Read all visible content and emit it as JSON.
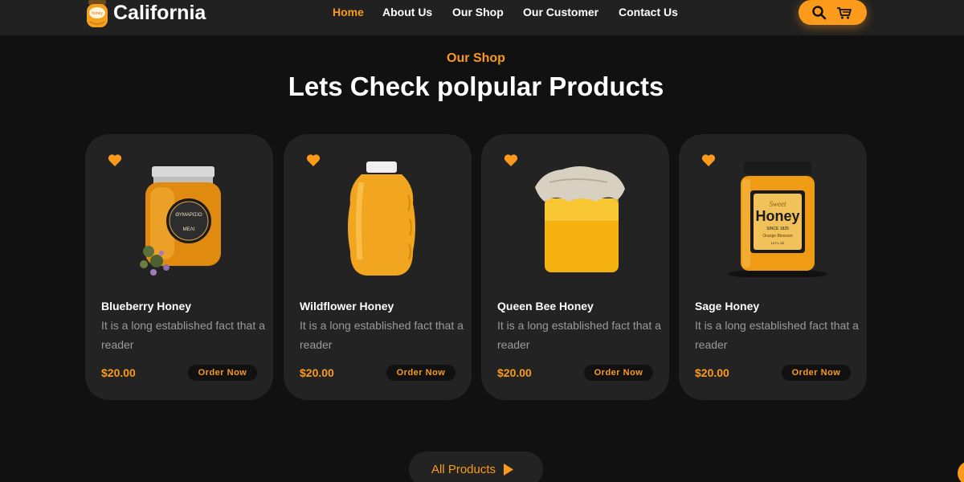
{
  "brand": {
    "name": "California",
    "jar_label": "honey"
  },
  "nav": {
    "items": [
      {
        "label": "Home",
        "active": true
      },
      {
        "label": "About Us",
        "active": false
      },
      {
        "label": "Our Shop",
        "active": false
      },
      {
        "label": "Our Customer",
        "active": false
      },
      {
        "label": "Contact Us",
        "active": false
      }
    ],
    "actions": {
      "search_icon": "search-icon",
      "cart_icon": "cart-icon"
    }
  },
  "section": {
    "label": "Our Shop",
    "title": "Lets Check polpular Products"
  },
  "products": [
    {
      "name": "Blueberry Honey",
      "description": "It is a long established fact that a reader",
      "price": "$20.00",
      "button": "Order Now",
      "image": "honey-jar-herbs",
      "image_text": {
        "label_top": "ΘΥΜΑΡΙΣΙΟ",
        "label_bottom": "ΜΕΛΙ"
      }
    },
    {
      "name": "Wildflower Honey",
      "description": "It is a long established fact that a reader",
      "price": "$20.00",
      "button": "Order Now",
      "image": "honey-bottle"
    },
    {
      "name": "Queen Bee Honey",
      "description": "It is a long established fact that a reader",
      "price": "$20.00",
      "button": "Order Now",
      "image": "honey-jar-cloth"
    },
    {
      "name": "Sage Honey",
      "description": "It is a long established fact that a reader",
      "price": "$20.00",
      "button": "Order Now",
      "image": "honey-jar-label",
      "image_text": {
        "label_top": "Sweet",
        "label_main": "Honey",
        "label_since": "SINCE 1825",
        "label_sub": "Orange Blossom",
        "label_size": "12 FL OZ"
      }
    }
  ],
  "all_products": {
    "label": "All Products"
  },
  "colors": {
    "accent": "#fb9a1b",
    "background": "#111111",
    "card": "#232323",
    "navbar": "#212121",
    "muted_text": "#9a9a9a"
  }
}
